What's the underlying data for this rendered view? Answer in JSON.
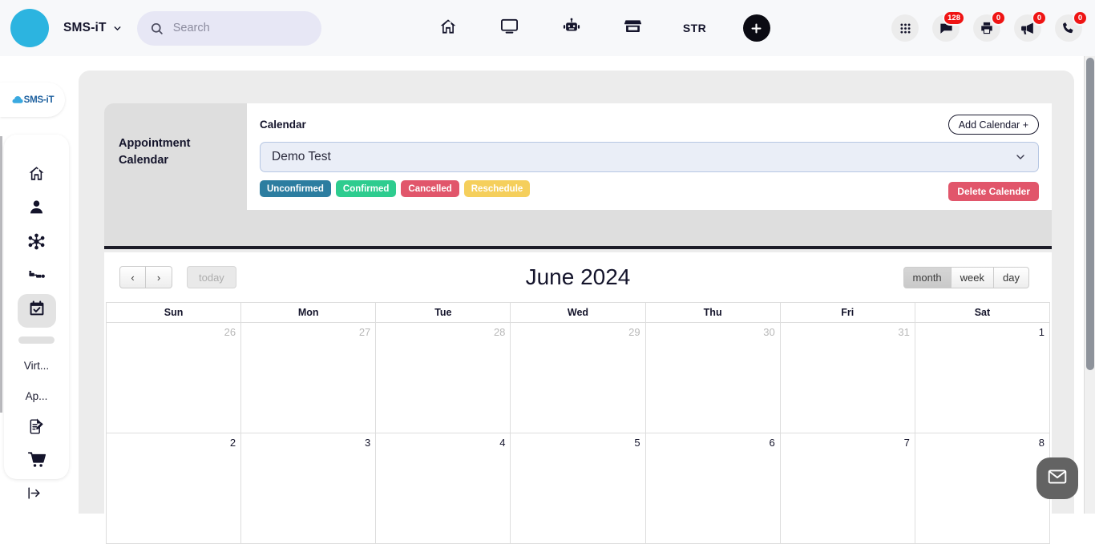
{
  "topbar": {
    "brand": "SMS-iT",
    "brand_caret_icon": "chevron-down-icon",
    "avatar_color": "#2cb4e0",
    "search": {
      "placeholder": "Search",
      "value": "",
      "icon": "search-icon"
    },
    "center_nav": [
      {
        "name": "home",
        "icon": "home-icon",
        "label": ""
      },
      {
        "name": "display",
        "icon": "monitor-icon",
        "label": ""
      },
      {
        "name": "bot",
        "icon": "robot-icon",
        "label": ""
      },
      {
        "name": "store",
        "icon": "store-icon",
        "label": ""
      },
      {
        "name": "str",
        "icon": "",
        "label": "STR"
      }
    ],
    "add_button": {
      "icon": "plus-icon",
      "label": "+"
    },
    "right_nav": [
      {
        "name": "apps",
        "icon": "grid-apps-icon",
        "badge": ""
      },
      {
        "name": "messages",
        "icon": "chat-bubble-icon",
        "badge": "128"
      },
      {
        "name": "print",
        "icon": "printer-icon",
        "badge": "0"
      },
      {
        "name": "announcements",
        "icon": "megaphone-icon",
        "badge": "0"
      },
      {
        "name": "calls",
        "icon": "phone-icon",
        "badge": "0"
      }
    ]
  },
  "sidebar": {
    "logo_text": "SMS-iT",
    "items": [
      {
        "name": "home",
        "icon": "home-icon",
        "label": "",
        "active": false
      },
      {
        "name": "contacts",
        "icon": "person-icon",
        "label": "",
        "active": false
      },
      {
        "name": "network",
        "icon": "share-nodes-icon",
        "label": "",
        "active": false
      },
      {
        "name": "pipeline",
        "icon": "pipeline-icon",
        "label": "",
        "active": false
      },
      {
        "name": "calendar",
        "icon": "calendar-check-icon",
        "label": "",
        "active": true
      }
    ],
    "text_items": [
      {
        "name": "virtual",
        "label": "Virt..."
      },
      {
        "name": "apps",
        "label": "Ap..."
      }
    ],
    "bottom_items": [
      {
        "name": "forms",
        "icon": "document-edit-icon"
      },
      {
        "name": "store",
        "icon": "shopping-cart-icon"
      }
    ],
    "logout_icon": "logout-arrow-icon"
  },
  "panel": {
    "title": "Appointment Calendar",
    "calendar_label": "Calendar",
    "add_calendar_label": "Add Calendar +",
    "delete_calendar_label": "Delete Calender",
    "select": {
      "value": "Demo Test",
      "caret_icon": "chevron-down-icon",
      "options": [
        "Demo Test"
      ]
    },
    "status_pills": [
      {
        "label": "Unconfirmed",
        "color": "#2c7da0"
      },
      {
        "label": "Confirmed",
        "color": "#2ecc8f"
      },
      {
        "label": "Cancelled",
        "color": "#e1566b"
      },
      {
        "label": "Reschedule",
        "color": "#f5cf5c",
        "text_color": "#ffffff"
      }
    ]
  },
  "calendar": {
    "prev_label": "‹",
    "next_label": "›",
    "today_label": "today",
    "today_disabled": true,
    "title": "June 2024",
    "views": [
      {
        "name": "month",
        "label": "month",
        "active": true
      },
      {
        "name": "week",
        "label": "week",
        "active": false
      },
      {
        "name": "day",
        "label": "day",
        "active": false
      }
    ],
    "weekday_headers": [
      "Sun",
      "Mon",
      "Tue",
      "Wed",
      "Thu",
      "Fri",
      "Sat"
    ],
    "weeks": [
      [
        {
          "n": "26",
          "other": true
        },
        {
          "n": "27",
          "other": true
        },
        {
          "n": "28",
          "other": true
        },
        {
          "n": "29",
          "other": true
        },
        {
          "n": "30",
          "other": true
        },
        {
          "n": "31",
          "other": true
        },
        {
          "n": "1",
          "other": false
        }
      ],
      [
        {
          "n": "2",
          "other": false
        },
        {
          "n": "3",
          "other": false
        },
        {
          "n": "4",
          "other": false
        },
        {
          "n": "5",
          "other": false
        },
        {
          "n": "6",
          "other": false
        },
        {
          "n": "7",
          "other": false
        },
        {
          "n": "8",
          "other": false
        }
      ]
    ]
  },
  "fab": {
    "icon": "envelope-icon",
    "label": ""
  }
}
